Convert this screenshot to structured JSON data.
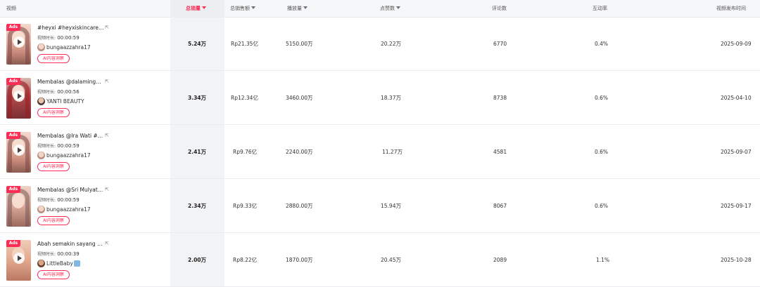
{
  "header": {
    "video": "视频",
    "total_sales": "总销量",
    "total_revenue": "总销售额",
    "views": "播放量",
    "likes": "点赞数",
    "comments": "评论数",
    "engagement": "互动率",
    "publish_time": "视频发布时间"
  },
  "labels": {
    "ads": "Ads",
    "duration_label": "视频时长:",
    "ai_button": "AI内容洞察"
  },
  "rows": [
    {
      "title": "#heyxi #heyxiskincare ...",
      "duration": "00:00:59",
      "author": "bungaazzahra17",
      "total_sales": "5.24万",
      "revenue": "Rp21.35亿",
      "views": "5150.00万",
      "likes": "20.22万",
      "comments": "6770",
      "engagement": "0.4%",
      "date": "2025-09-09"
    },
    {
      "title": "Membalas @dalamingat...",
      "duration": "00:00:56",
      "author": "YANTI BEAUTY",
      "total_sales": "3.34万",
      "revenue": "Rp12.34亿",
      "views": "3460.00万",
      "likes": "18.37万",
      "comments": "8738",
      "engagement": "0.6%",
      "date": "2025-04-10"
    },
    {
      "title": "Membalas @Ira Wati #h...",
      "duration": "00:00:59",
      "author": "bungaazzahra17",
      "total_sales": "2.41万",
      "revenue": "Rp9.76亿",
      "views": "2240.00万",
      "likes": "11.27万",
      "comments": "4581",
      "engagement": "0.6%",
      "date": "2025-09-07"
    },
    {
      "title": "Membalas @Sri Mulyati ...",
      "duration": "00:00:59",
      "author": "bungaazzahra17",
      "total_sales": "2.34万",
      "revenue": "Rp9.33亿",
      "views": "2880.00万",
      "likes": "15.94万",
      "comments": "8067",
      "engagement": "0.6%",
      "date": "2025-09-17"
    },
    {
      "title": "Abah semakin sayang c...",
      "duration": "00:00:39",
      "author": "LittleBaby",
      "total_sales": "2.00万",
      "revenue": "Rp8.22亿",
      "views": "1870.00万",
      "likes": "20.45万",
      "comments": "2089",
      "engagement": "1.1%",
      "date": "2025-10-28"
    }
  ],
  "colors": {
    "accent": "#fe2c55",
    "sorted_column_bg": "#f2f3f5"
  }
}
